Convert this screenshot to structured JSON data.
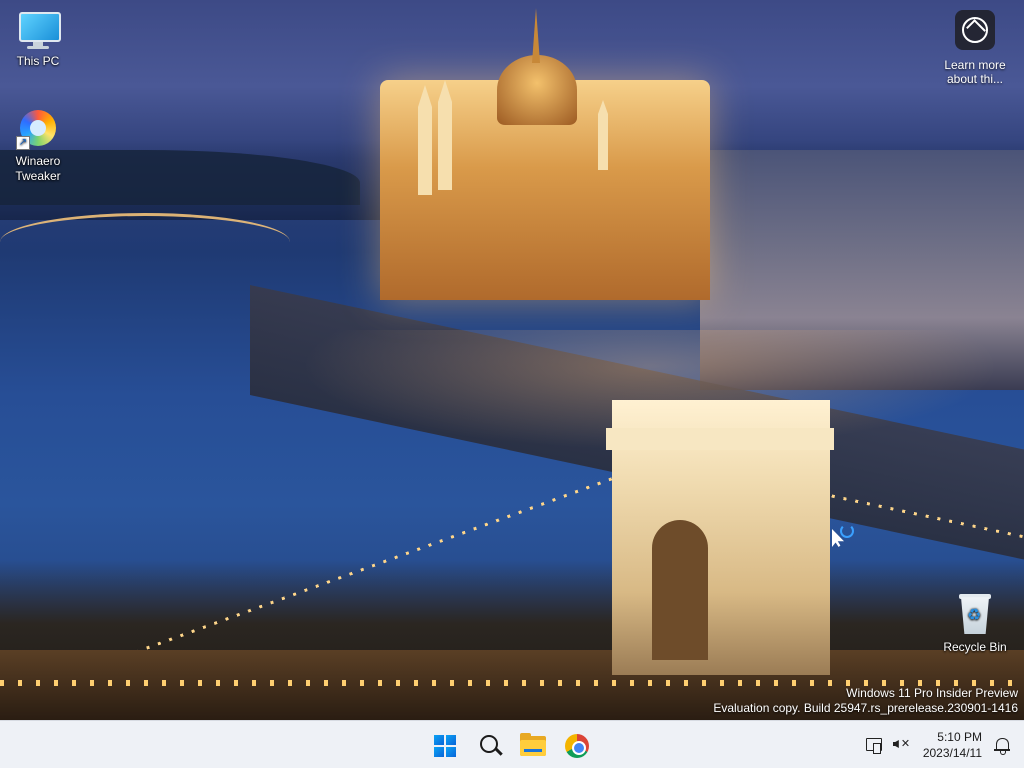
{
  "desktop": {
    "icons": [
      {
        "label": "This PC"
      },
      {
        "label": "Winaero Tweaker"
      },
      {
        "label": "Recycle Bin"
      }
    ],
    "spotlight": {
      "label": "Learn more about thi..."
    },
    "watermark": {
      "line1": "Windows 11 Pro Insider Preview",
      "line2": "Evaluation copy. Build 25947.rs_prerelease.230901-1416"
    }
  },
  "taskbar": {
    "pinned": [
      {
        "icon": "windows-start-icon"
      },
      {
        "icon": "search-icon"
      },
      {
        "icon": "file-explorer-icon"
      },
      {
        "icon": "chrome-icon"
      }
    ],
    "clock": {
      "time": "5:10 PM",
      "date": "2023/14/11"
    }
  }
}
